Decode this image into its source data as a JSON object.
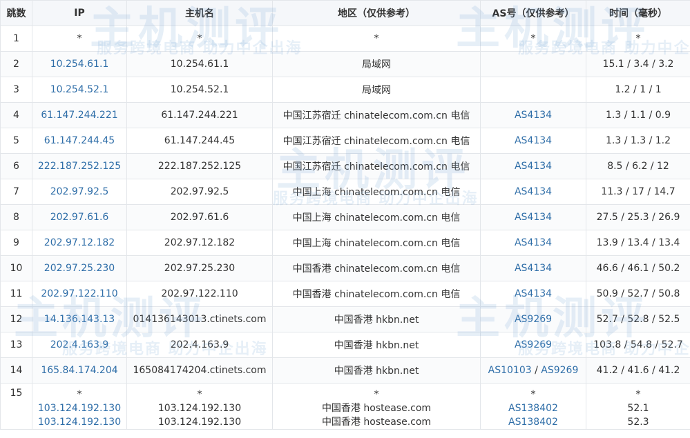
{
  "headers": [
    "跳数",
    "IP",
    "主机名",
    "地区（仅供参考）",
    "AS号（仅供参考）",
    "时间（毫秒）"
  ],
  "rows": [
    {
      "hop": "1",
      "ip": "*",
      "host": "*",
      "region": "*",
      "as": "*",
      "time": "*"
    },
    {
      "hop": "2",
      "ip": "10.254.61.1",
      "host": "10.254.61.1",
      "region": "局域网",
      "as": "",
      "time": "15.1 / 3.4 / 3.2"
    },
    {
      "hop": "3",
      "ip": "10.254.52.1",
      "host": "10.254.52.1",
      "region": "局域网",
      "as": "",
      "time": "1.2 / 1 / 1"
    },
    {
      "hop": "4",
      "ip": "61.147.244.221",
      "host": "61.147.244.221",
      "region": "中国江苏宿迁 chinatelecom.com.cn 电信",
      "as": "AS4134",
      "time": "1.3 / 1.1 / 0.9"
    },
    {
      "hop": "5",
      "ip": "61.147.244.45",
      "host": "61.147.244.45",
      "region": "中国江苏宿迁 chinatelecom.com.cn 电信",
      "as": "AS4134",
      "time": "1.3 / 1.3 / 1.2"
    },
    {
      "hop": "6",
      "ip": "222.187.252.125",
      "host": "222.187.252.125",
      "region": "中国江苏宿迁 chinatelecom.com.cn 电信",
      "as": "AS4134",
      "time": "8.5 / 6.2 / 12"
    },
    {
      "hop": "7",
      "ip": "202.97.92.5",
      "host": "202.97.92.5",
      "region": "中国上海 chinatelecom.com.cn 电信",
      "as": "AS4134",
      "time": "11.3 / 17 / 14.7"
    },
    {
      "hop": "8",
      "ip": "202.97.61.6",
      "host": "202.97.61.6",
      "region": "中国上海 chinatelecom.com.cn 电信",
      "as": "AS4134",
      "time": "27.5 / 25.3 / 26.9"
    },
    {
      "hop": "9",
      "ip": "202.97.12.182",
      "host": "202.97.12.182",
      "region": "中国上海 chinatelecom.com.cn 电信",
      "as": "AS4134",
      "time": "13.9 / 13.4 / 13.4"
    },
    {
      "hop": "10",
      "ip": "202.97.25.230",
      "host": "202.97.25.230",
      "region": "中国香港 chinatelecom.com.cn 电信",
      "as": "AS4134",
      "time": "46.6 / 46.1 / 50.2"
    },
    {
      "hop": "11",
      "ip": "202.97.122.110",
      "host": "202.97.122.110",
      "region": "中国香港 chinatelecom.com.cn 电信",
      "as": "AS4134",
      "time": "50.9 / 52.7 / 50.8"
    },
    {
      "hop": "12",
      "ip": "14.136.143.13",
      "host": "014136143013.ctinets.com",
      "region": "中国香港 hkbn.net",
      "as": "AS9269",
      "time": "52.7 / 52.8 / 52.5"
    },
    {
      "hop": "13",
      "ip": "202.4.163.9",
      "host": "202.4.163.9",
      "region": "中国香港 hkbn.net",
      "as": "AS9269",
      "time": "103.8 / 54.8 / 52.7"
    },
    {
      "hop": "14",
      "ip": "165.84.174.204",
      "host": "165084174204.ctinets.com",
      "region": "中国香港 hkbn.net",
      "as": "AS10103 / AS9269",
      "time": "41.2 / 41.6 / 41.2"
    }
  ],
  "last_row": {
    "hop": "15",
    "ip": [
      "*",
      "103.124.192.130",
      "103.124.192.130"
    ],
    "host": [
      "*",
      "103.124.192.130",
      "103.124.192.130"
    ],
    "region": [
      "*",
      "中国香港 hostease.com",
      "中国香港 hostease.com"
    ],
    "as": [
      "*",
      "AS138402",
      "AS138402"
    ],
    "time": [
      "*",
      "52.1",
      "52.3"
    ]
  },
  "watermark": {
    "logo": "主机测评",
    "slogan": "服务跨境电商 助力中企出海"
  }
}
